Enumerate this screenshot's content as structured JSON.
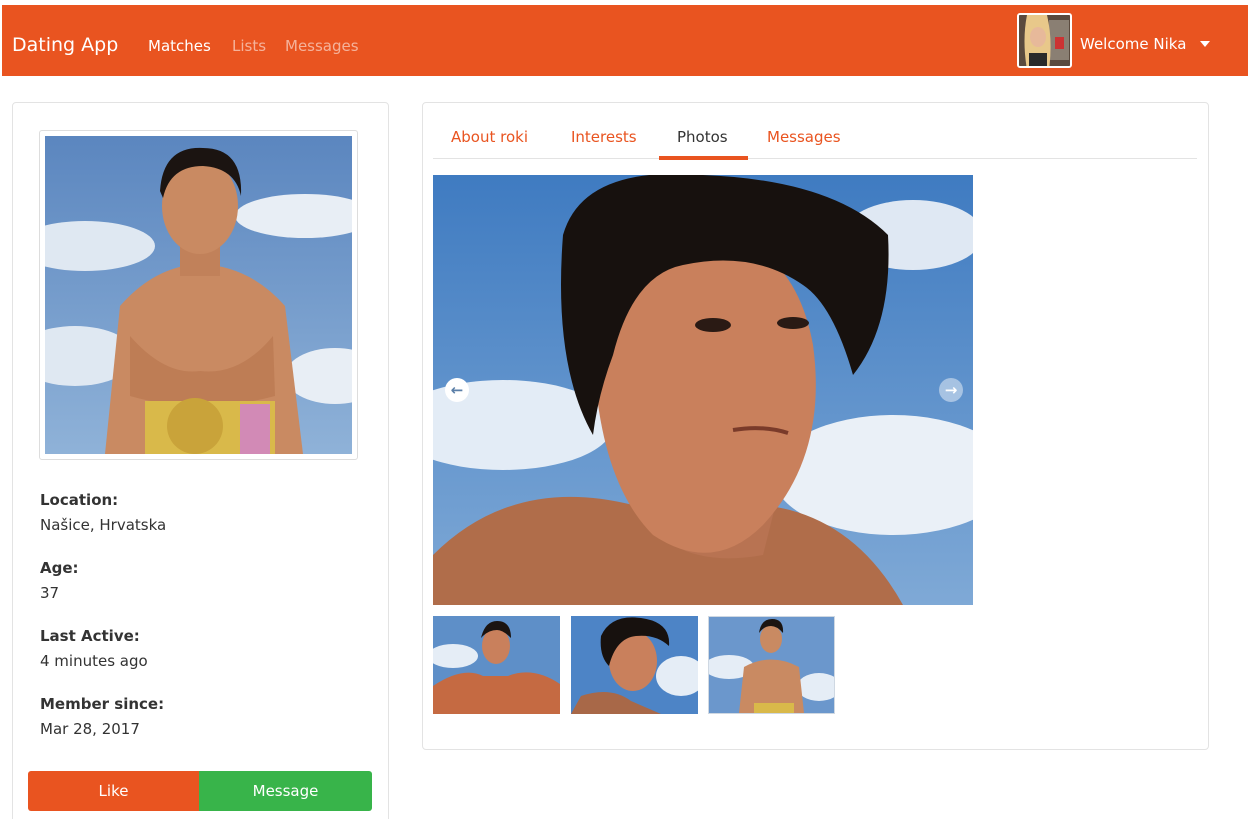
{
  "navbar": {
    "brand": "Dating App",
    "links": [
      "Matches",
      "Lists",
      "Messages"
    ],
    "welcome": "Welcome Nika",
    "color": "#E95420"
  },
  "profile": {
    "fields": [
      {
        "label": "Location:",
        "value": "Našice, Hrvatska"
      },
      {
        "label": "Age:",
        "value": "37"
      },
      {
        "label": "Last Active:",
        "value": "4 minutes ago"
      },
      {
        "label": "Member since:",
        "value": "Mar 28, 2017"
      }
    ],
    "like_label": "Like",
    "message_label": "Message",
    "like_color": "#E95420",
    "message_color": "#38B44A"
  },
  "tabs": {
    "items": [
      "About roki",
      "Interests",
      "Photos",
      "Messages"
    ],
    "active": "Photos"
  },
  "gallery": {
    "prev_icon": "arrow-circle-left-icon",
    "next_icon": "arrow-circle-right-icon",
    "thumbnail_count": 3
  }
}
